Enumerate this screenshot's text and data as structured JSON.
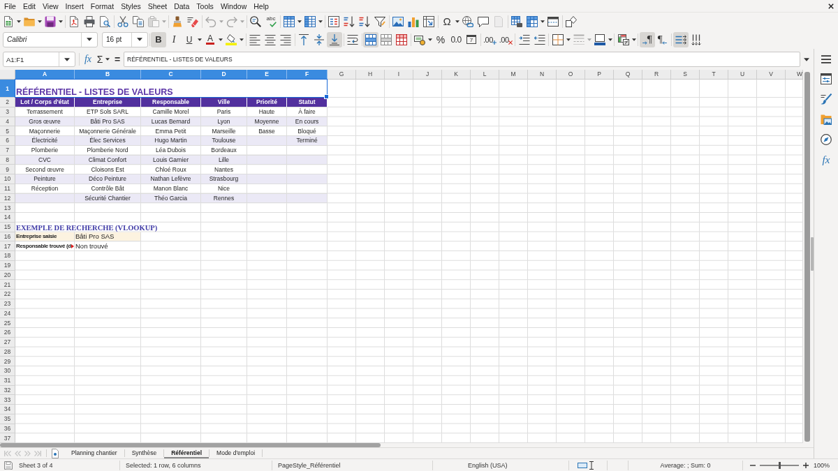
{
  "menu_bar": {
    "items": [
      "File",
      "Edit",
      "View",
      "Insert",
      "Format",
      "Styles",
      "Sheet",
      "Data",
      "Tools",
      "Window",
      "Help"
    ]
  },
  "standard_toolbar": {
    "spelling_label": "abc",
    "special_character_label": "Ω",
    "disabled": {
      "paste": true,
      "undo": true,
      "redo": true,
      "headers_footers": true
    }
  },
  "formatting_toolbar": {
    "font_name": "Calibri",
    "font_size": "16 pt",
    "labels": {
      "bold": "B",
      "italic": "I",
      "underline": "U",
      "font_color": "A",
      "percent": "%",
      "number": "0.0",
      "add_decimal": ".00",
      "delete_decimal": ".00",
      "date": "7",
      "left_to_right": "¶",
      "right_to_left": "¶"
    },
    "pressed": {
      "bold": true,
      "italic": false,
      "underline": false,
      "align_left": false,
      "align_center": false,
      "align_right": false,
      "align_top": false,
      "align_center_vertically": false,
      "align_bottom": true,
      "wrap_text": false,
      "merge_and_center": true,
      "left_to_right": true,
      "right_to_left": false,
      "text_left_to_right": true,
      "text_top_to_bottom": false
    },
    "disabled": {
      "border_style": true
    }
  },
  "formula_bar": {
    "name_box": "A1:F1",
    "function_wizard": "fx",
    "sum": "Σ",
    "equals": "=",
    "content": "RÉFÉRENTIEL - LISTES DE VALEURS"
  },
  "sheet": {
    "columns": [
      {
        "label": "A",
        "selected": true
      },
      {
        "label": "B",
        "selected": true
      },
      {
        "label": "C",
        "selected": true
      },
      {
        "label": "D",
        "selected": true
      },
      {
        "label": "E",
        "selected": true
      },
      {
        "label": "F",
        "selected": true
      },
      {
        "label": "G",
        "selected": false
      },
      {
        "label": "H",
        "selected": false
      },
      {
        "label": "I",
        "selected": false
      },
      {
        "label": "J",
        "selected": false
      },
      {
        "label": "K",
        "selected": false
      },
      {
        "label": "L",
        "selected": false
      },
      {
        "label": "M",
        "selected": false
      },
      {
        "label": "N",
        "selected": false
      },
      {
        "label": "O",
        "selected": false
      },
      {
        "label": "P",
        "selected": false
      },
      {
        "label": "Q",
        "selected": false
      },
      {
        "label": "R",
        "selected": false
      },
      {
        "label": "S",
        "selected": false
      },
      {
        "label": "T",
        "selected": false
      },
      {
        "label": "U",
        "selected": false
      },
      {
        "label": "V",
        "selected": false
      },
      {
        "label": "W",
        "selected": false
      }
    ],
    "rows": [
      {
        "number": "1",
        "selected": true
      },
      {
        "number": "2",
        "selected": false
      },
      {
        "number": "3",
        "selected": false
      },
      {
        "number": "4",
        "selected": false
      },
      {
        "number": "5",
        "selected": false
      },
      {
        "number": "6",
        "selected": false
      },
      {
        "number": "7",
        "selected": false
      },
      {
        "number": "8",
        "selected": false
      },
      {
        "number": "9",
        "selected": false
      },
      {
        "number": "10",
        "selected": false
      },
      {
        "number": "11",
        "selected": false
      },
      {
        "number": "12",
        "selected": false
      },
      {
        "number": "13",
        "selected": false
      },
      {
        "number": "14",
        "selected": false
      },
      {
        "number": "15",
        "selected": false
      },
      {
        "number": "16",
        "selected": false
      },
      {
        "number": "17",
        "selected": false
      },
      {
        "number": "18",
        "selected": false
      },
      {
        "number": "19",
        "selected": false
      },
      {
        "number": "20",
        "selected": false
      },
      {
        "number": "21",
        "selected": false
      },
      {
        "number": "22",
        "selected": false
      },
      {
        "number": "23",
        "selected": false
      },
      {
        "number": "24",
        "selected": false
      },
      {
        "number": "25",
        "selected": false
      },
      {
        "number": "26",
        "selected": false
      },
      {
        "number": "27",
        "selected": false
      },
      {
        "number": "28",
        "selected": false
      },
      {
        "number": "29",
        "selected": false
      },
      {
        "number": "30",
        "selected": false
      },
      {
        "number": "31",
        "selected": false
      },
      {
        "number": "32",
        "selected": false
      },
      {
        "number": "33",
        "selected": false
      },
      {
        "number": "34",
        "selected": false
      },
      {
        "number": "35",
        "selected": false
      },
      {
        "number": "36",
        "selected": false
      },
      {
        "number": "37",
        "selected": false
      }
    ],
    "title": "RÉFÉRENTIEL - LISTES DE VALEURS",
    "table": {
      "banded_rows": true,
      "columns": [
        {
          "header": "Lot / Corps d'état",
          "values": [
            "Terrassement",
            "Gros œuvre",
            "Maçonnerie",
            "Électricité",
            "Plomberie",
            "CVC",
            "Second œuvre",
            "Peinture",
            "Réception"
          ]
        },
        {
          "header": "Entreprise",
          "values": [
            "ETP Sols SARL",
            "Bâti Pro SAS",
            "Maçonnerie Générale",
            "Élec Services",
            "Plomberie Nord",
            "Climat Confort",
            "Cloisons Est",
            "Déco Peinture",
            "Contrôle Bât",
            "Sécurité Chantier"
          ]
        },
        {
          "header": "Responsable",
          "values": [
            "Camille Morel",
            "Lucas Bernard",
            "Emma Petit",
            "Hugo Martin",
            "Léa Dubois",
            "Louis Garnier",
            "Chloé Roux",
            "Nathan Lefèvre",
            "Manon Blanc",
            "Théo Garcia"
          ]
        },
        {
          "header": "Ville",
          "values": [
            "Paris",
            "Lyon",
            "Marseille",
            "Toulouse",
            "Bordeaux",
            "Lille",
            "Nantes",
            "Strasbourg",
            "Nice",
            "Rennes"
          ]
        },
        {
          "header": "Priorité",
          "values": [
            "Haute",
            "Moyenne",
            "Basse"
          ]
        },
        {
          "header": "Statut",
          "values": [
            "À faire",
            "En cours",
            "Bloqué",
            "Terminé"
          ]
        }
      ]
    },
    "lookup": {
      "title": "EXEMPLE DE RECHERCHE (VLOOKUP)",
      "fields": [
        {
          "label": "Entreprise saisie",
          "value": "Bâti Pro SAS",
          "highlighted": true,
          "clipped": false
        },
        {
          "label": "Responsable trouvé (d",
          "value": "Non trouvé",
          "highlighted": false,
          "clipped": true
        }
      ]
    }
  },
  "sheet_tabs": {
    "navigation_disabled": true,
    "tabs": [
      {
        "label": "Planning chantier",
        "selected": false
      },
      {
        "label": "Synthèse",
        "selected": false
      },
      {
        "label": "Référentiel",
        "selected": true
      },
      {
        "label": "Mode d'emploi",
        "selected": false
      }
    ]
  },
  "sidebar": {
    "functions_label": "fx"
  },
  "status_bar": {
    "sheet": "Sheet 3 of 4",
    "selection": "Selected: 1 row, 6 columns",
    "page_style": "PageStyle_Référentiel",
    "language": "English (USA)",
    "summary": "Average: ; Sum: 0",
    "zoom": {
      "level": 0.5,
      "label": "100%"
    }
  }
}
